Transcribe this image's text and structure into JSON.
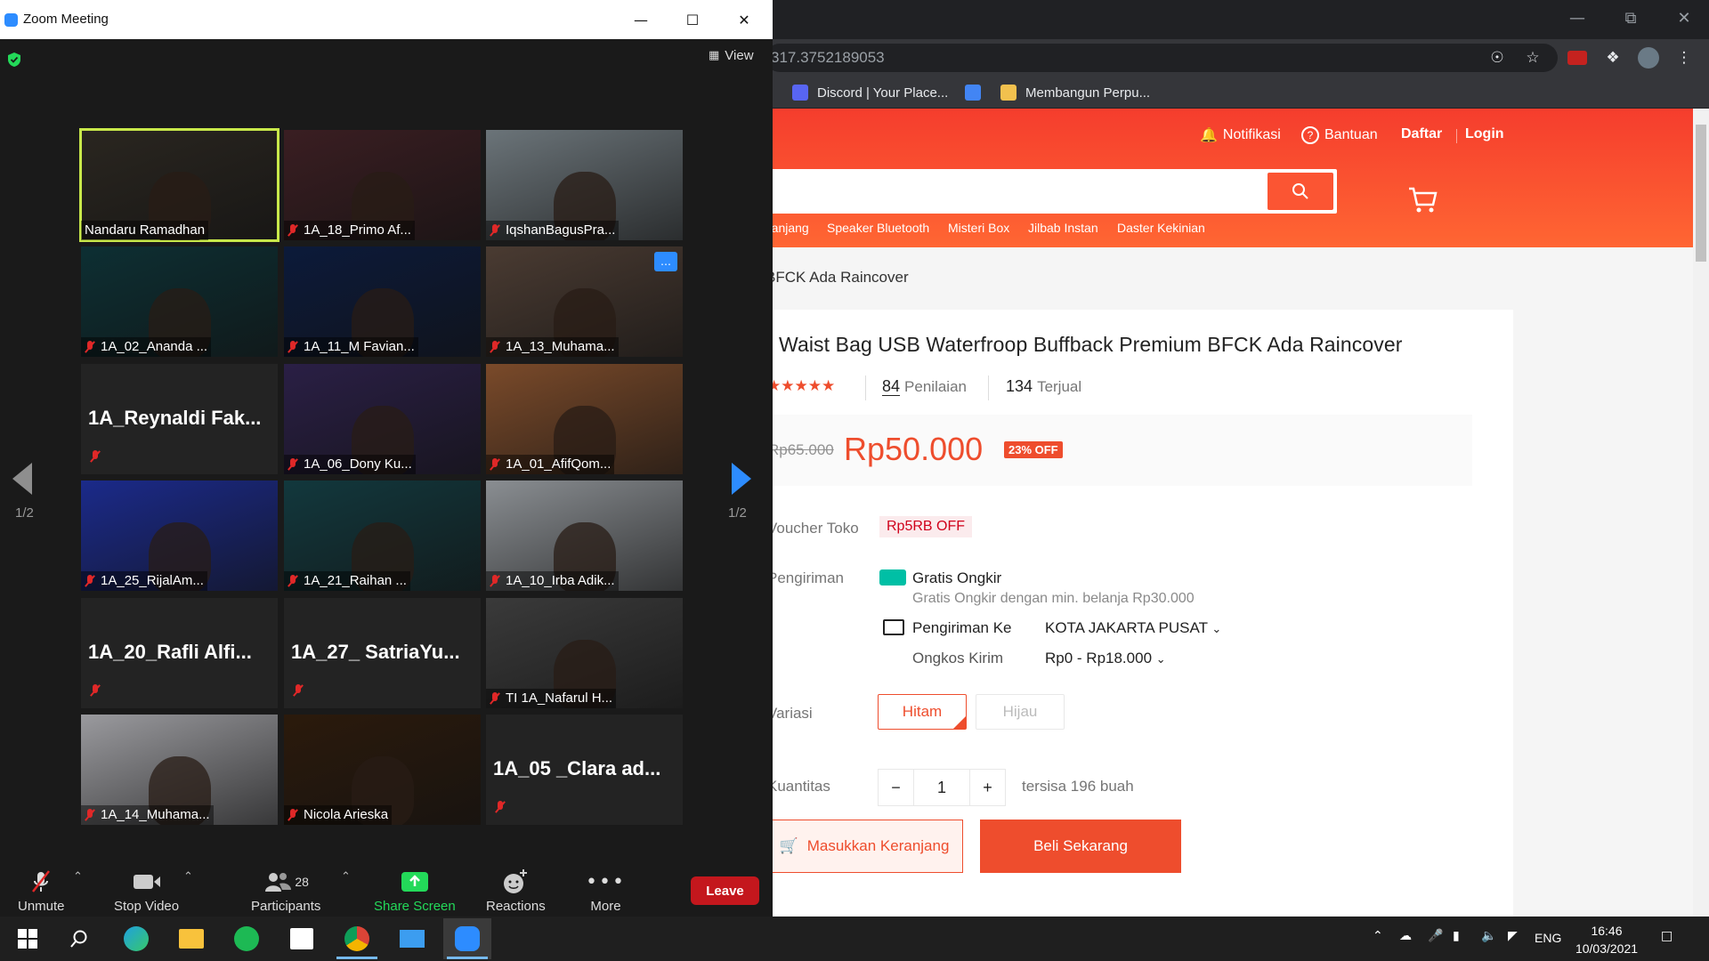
{
  "chrome": {
    "omnibox_text": "317.3752189053",
    "bookmarks": [
      "Discord | Your Place...",
      "Membangun Perpu..."
    ]
  },
  "shopee": {
    "header": {
      "notifications": "Notifikasi",
      "help": "Bantuan",
      "register": "Daftar",
      "login": "Login"
    },
    "keywords": [
      "ranjang",
      "Speaker Bluetooth",
      "Misteri Box",
      "Jilbab Instan",
      "Daster Kekinian"
    ],
    "breadcrumb": "BFCK Ada Raincover",
    "product": {
      "title": "Waist Bag USB Waterfroop Buffback Premium BFCK Ada Raincover",
      "rating_stars": "★★★★★",
      "ratings_count": "84",
      "ratings_label": "Penilaian",
      "sold_count": "134",
      "sold_label": "Terjual",
      "old_price": "Rp65.000",
      "price": "Rp50.000",
      "discount": "23% OFF",
      "voucher_label": "Voucher Toko",
      "voucher_value": "Rp5RB OFF",
      "shipping_label": "Pengiriman",
      "free_shipping": "Gratis Ongkir",
      "free_shipping_note": "Gratis Ongkir dengan min. belanja Rp30.000",
      "ship_to_label": "Pengiriman Ke",
      "ship_to_value": "KOTA JAKARTA PUSAT",
      "ship_cost_label": "Ongkos Kirim",
      "ship_cost_value": "Rp0 - Rp18.000",
      "variant_label": "Variasi",
      "variants": [
        "Hitam",
        "Hijau"
      ],
      "quantity_label": "Kuantitas",
      "quantity": "1",
      "stock": "tersisa 196 buah",
      "add_to_cart": "Masukkan Keranjang",
      "buy_now": "Beli Sekarang"
    }
  },
  "zoom": {
    "title": "Zoom Meeting",
    "view_label": "View",
    "page_indicator": "1/2",
    "participants": [
      {
        "name": "Nandaru Ramadhan",
        "mode": "video",
        "bg": "#2a2620",
        "muted": false,
        "active": true
      },
      {
        "name": "1A_18_Primo Af...",
        "mode": "video",
        "bg": "#3a1e22",
        "muted": true
      },
      {
        "name": "IqshanBagusPra...",
        "mode": "video",
        "bg": "#6b7479",
        "muted": true
      },
      {
        "name": "1A_02_Ananda ...",
        "mode": "video",
        "bg": "#0d2f33",
        "muted": true
      },
      {
        "name": "1A_11_M Favian...",
        "mode": "video",
        "bg": "#0c1a3a",
        "muted": true
      },
      {
        "name": "1A_13_Muhama...",
        "mode": "video",
        "bg": "#4a3b32",
        "muted": true
      },
      {
        "name": "1A_Reynaldi  Fak...",
        "mode": "name",
        "muted": true
      },
      {
        "name": "1A_06_Dony Ku...",
        "mode": "video",
        "bg": "#2a1f45",
        "muted": true
      },
      {
        "name": "1A_01_AfifQom...",
        "mode": "video",
        "bg": "#7a4a2a",
        "muted": true
      },
      {
        "name": "1A_25_RijalAm...",
        "mode": "video",
        "bg": "#1b2a8a",
        "muted": true
      },
      {
        "name": "1A_21_Raihan ...",
        "mode": "video",
        "bg": "#12383d",
        "muted": true
      },
      {
        "name": "1A_10_Irba Adik...",
        "mode": "video",
        "bg": "#8a8e92",
        "muted": true
      },
      {
        "name": "1A_20_Rafli  Alfi...",
        "mode": "name",
        "muted": true
      },
      {
        "name": "1A_27_  SatriaYu...",
        "mode": "name",
        "muted": true
      },
      {
        "name": "TI 1A_Nafarul H...",
        "mode": "video",
        "bg": "#3a3a3a",
        "muted": true
      },
      {
        "name": "1A_14_Muhama...",
        "mode": "video",
        "bg": "#9a9a9e",
        "muted": true
      },
      {
        "name": "Nicola Arieska",
        "mode": "video",
        "bg": "#2b1a0c",
        "muted": true
      },
      {
        "name": "1A_05  _Clara ad...",
        "mode": "name",
        "muted": true
      }
    ],
    "toolbar": {
      "unmute": "Unmute",
      "stop_video": "Stop Video",
      "participants": "Participants",
      "participants_count": "28",
      "share_screen": "Share Screen",
      "reactions": "Reactions",
      "more": "More",
      "leave": "Leave"
    }
  },
  "taskbar": {
    "language": "ENG",
    "time": "16:46",
    "date": "10/03/2021"
  }
}
